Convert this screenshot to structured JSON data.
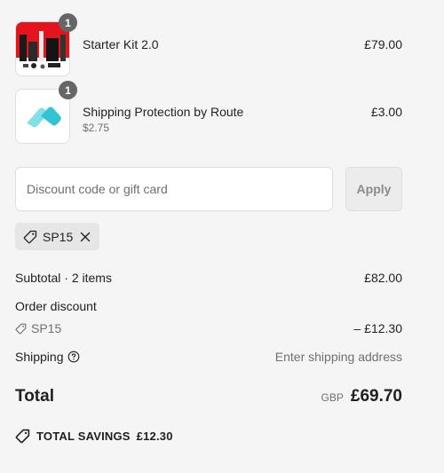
{
  "line_items": [
    {
      "quantity": "1",
      "title": "Starter Kit 2.0",
      "subtitle": "",
      "price": "£79.00",
      "image_icon": "starter-kit-product-image"
    },
    {
      "quantity": "1",
      "title": "Shipping Protection by Route",
      "subtitle": "$2.75",
      "price": "£3.00",
      "image_icon": "route-logo"
    }
  ],
  "discount": {
    "placeholder": "Discount code or gift card",
    "value": "",
    "apply_label": "Apply",
    "applied_code": "SP15"
  },
  "summary": {
    "subtotal_label": "Subtotal · 2 items",
    "subtotal_value": "£82.00",
    "order_discount_label": "Order discount",
    "discount_code": "SP15",
    "discount_value": "– £12.30",
    "shipping_label": "Shipping",
    "shipping_value": "Enter shipping address",
    "total_label": "Total",
    "total_currency": "GBP",
    "total_value": "£69.70",
    "savings_label": "TOTAL SAVINGS",
    "savings_value": "£12.30"
  },
  "colors": {
    "background": "#f5f5f5",
    "badge": "#666666",
    "route_accent": "#3cc9d8",
    "kit_red": "#e3141e"
  }
}
